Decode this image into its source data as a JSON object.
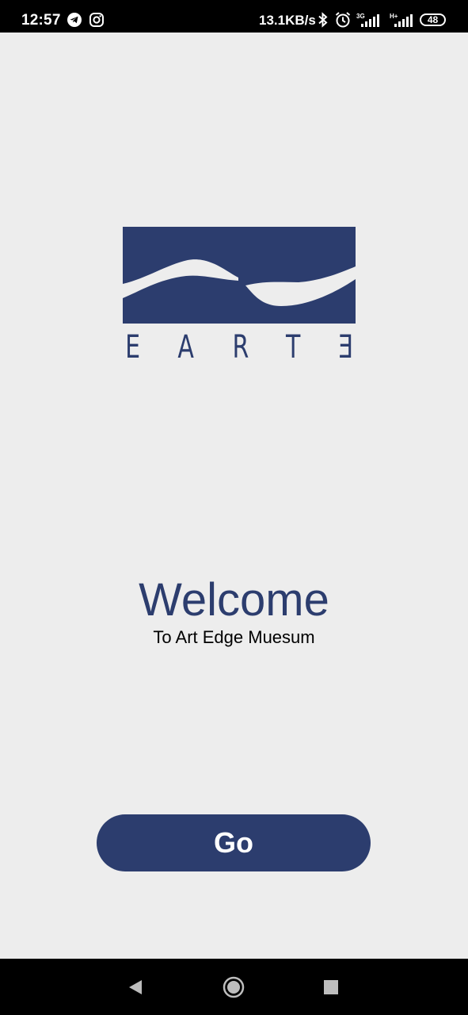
{
  "status_bar": {
    "time": "12:57",
    "speed": "13.1KB/s",
    "net1_label": "3G",
    "net2_label": "H+",
    "battery": "48",
    "icons": [
      "telegram-icon",
      "instagram-icon",
      "bluetooth-icon",
      "alarm-icon",
      "signal-icon",
      "signal-icon"
    ]
  },
  "logo": {
    "letters": [
      "E",
      "A",
      "R",
      "T",
      "E"
    ]
  },
  "welcome": {
    "title": "Welcome",
    "subtitle": "To Art Edge Muesum"
  },
  "go_button": {
    "label": "Go"
  },
  "nav_bar": {
    "icons": [
      "back-icon",
      "home-icon",
      "recents-icon"
    ]
  },
  "colors": {
    "brand": "#2c3d6e",
    "background": "#ededed"
  }
}
